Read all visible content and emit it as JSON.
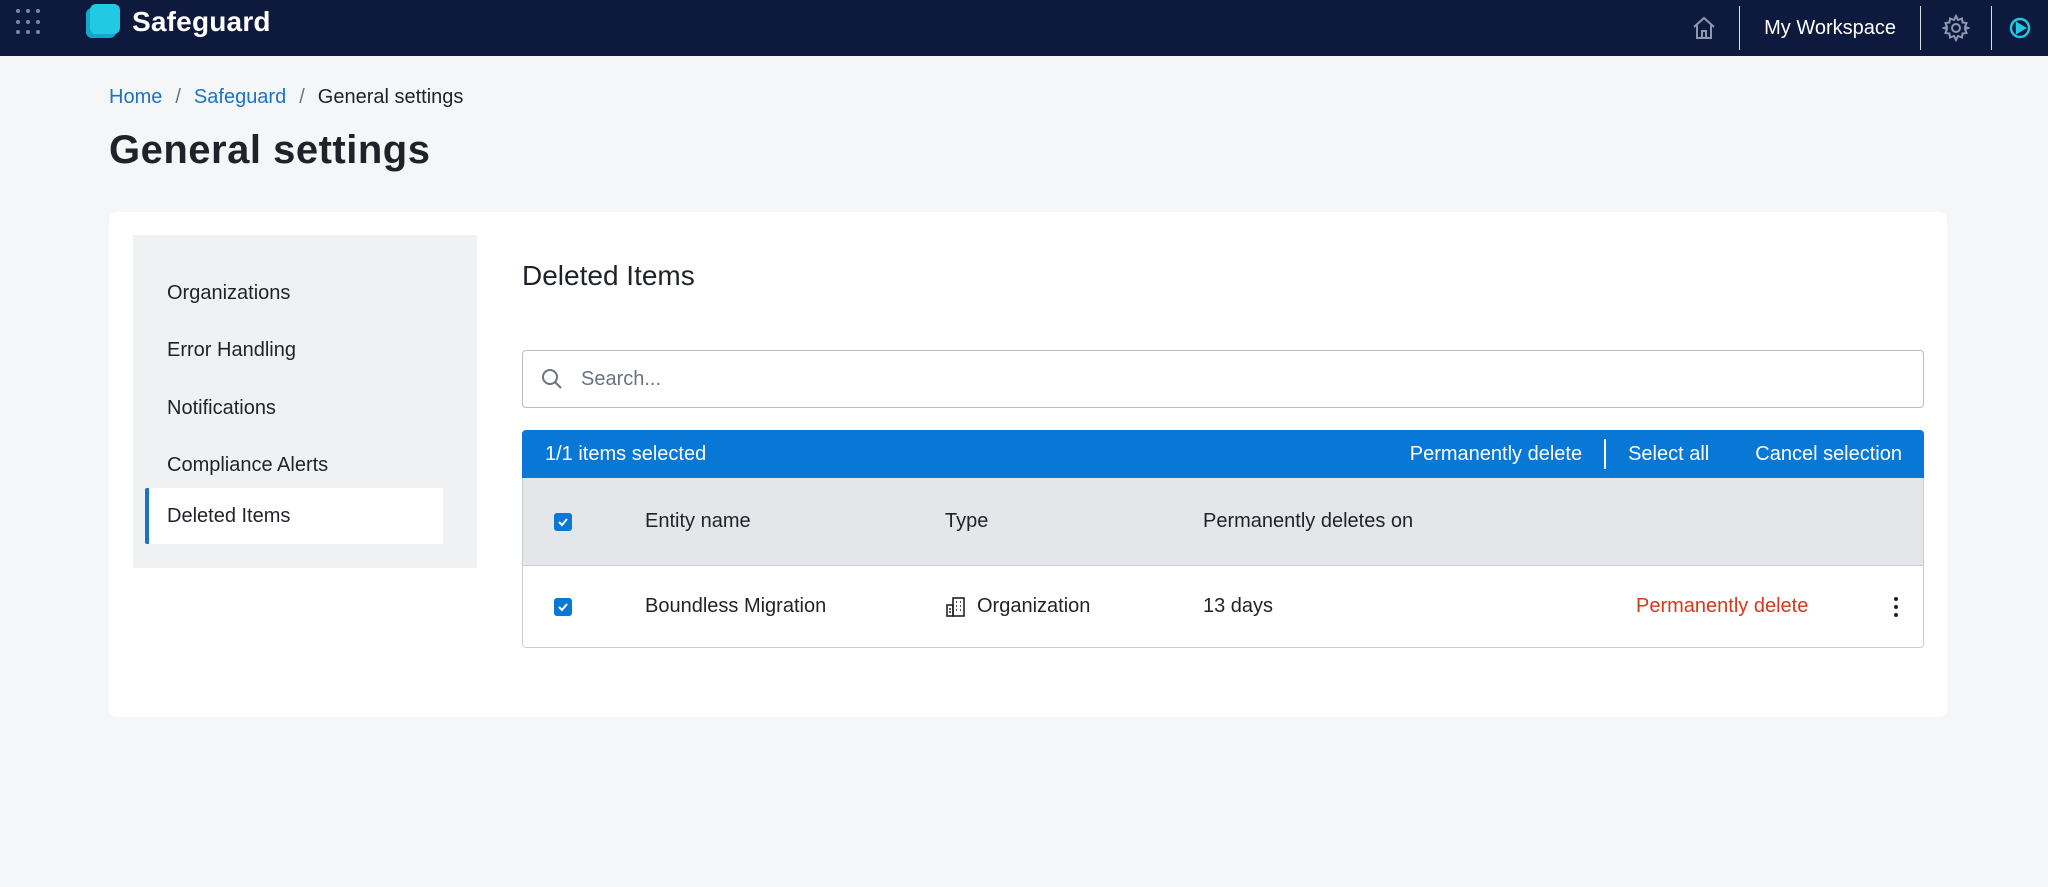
{
  "app": {
    "brand": "Safeguard",
    "workspace_label": "My Workspace",
    "icons": [
      "apps-grid-icon",
      "logo-icon",
      "home-icon",
      "gear-icon",
      "product-switch-icon"
    ],
    "colors": {
      "topbar": "#0e1a3d",
      "accent": "#0877d6",
      "logo": "#22c9e3",
      "danger": "#d0391c"
    }
  },
  "breadcrumb": {
    "items": [
      {
        "label": "Home"
      },
      {
        "label": "Safeguard"
      },
      {
        "label": "General settings"
      }
    ],
    "separator": "/"
  },
  "page": {
    "title": "General settings"
  },
  "sidebar": {
    "items": [
      {
        "label": "Organizations"
      },
      {
        "label": "Error Handling"
      },
      {
        "label": "Notifications"
      },
      {
        "label": "Compliance Alerts"
      },
      {
        "label": "Deleted Items"
      }
    ],
    "active": "Deleted Items"
  },
  "main": {
    "section_title": "Deleted Items",
    "search": {
      "placeholder": "Search...",
      "value": ""
    },
    "selection_bar": {
      "count_text": "1/1 items selected",
      "actions": [
        "Permanently delete",
        "Select all",
        "Cancel selection"
      ]
    },
    "table": {
      "headers": [
        "Entity name",
        "Type",
        "Permanently deletes on"
      ],
      "header_checkbox_checked": true,
      "rows": [
        {
          "checked": true,
          "entity_name": "Boundless Migration",
          "type": "Organization",
          "type_icon": "building-icon",
          "deletes_on": "13 days",
          "action": "Permanently delete"
        }
      ]
    }
  }
}
